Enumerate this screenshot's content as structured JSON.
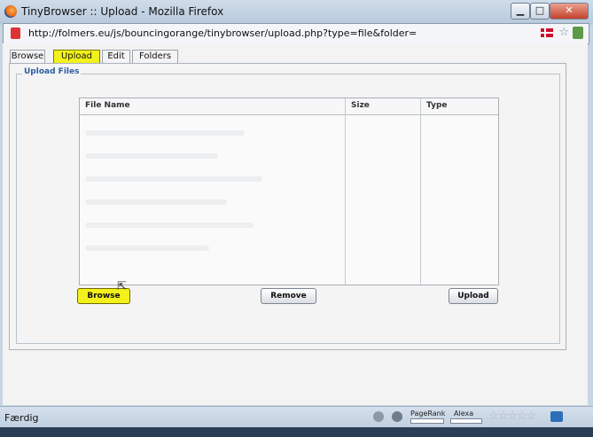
{
  "window": {
    "title": "TinyBrowser :: Upload - Mozilla Firefox",
    "controls": [
      "minimize",
      "maximize",
      "close"
    ]
  },
  "address_bar": {
    "url": "http://folmers.eu/js/bouncingorange/tinybrowser/upload.php?type=file&folder="
  },
  "tabs": [
    {
      "label": "Browse"
    },
    {
      "label": "Upload",
      "active": true
    },
    {
      "label": "Edit"
    },
    {
      "label": "Folders"
    }
  ],
  "upload_panel": {
    "legend": "Upload Files",
    "columns": [
      "File Name",
      "Size",
      "Type"
    ]
  },
  "buttons": {
    "browse": "Browse",
    "remove": "Remove",
    "upload": "Upload"
  },
  "status_bar": {
    "text": "Færdig",
    "pagerank_label": "PageRank",
    "alexa_label": "Alexa"
  },
  "colors": {
    "highlight": "#f2f11a",
    "legend": "#2b5fa3",
    "chrome": "#c9d5e3"
  },
  "icons": [
    "firefox-logo-icon",
    "page-favicon-icon",
    "danish-flag-icon",
    "bookmark-star-icon",
    "go-icon",
    "addon-icon",
    "globe-icon",
    "rating-stars-icon",
    "extension-icon",
    "mouse-cursor-icon"
  ]
}
